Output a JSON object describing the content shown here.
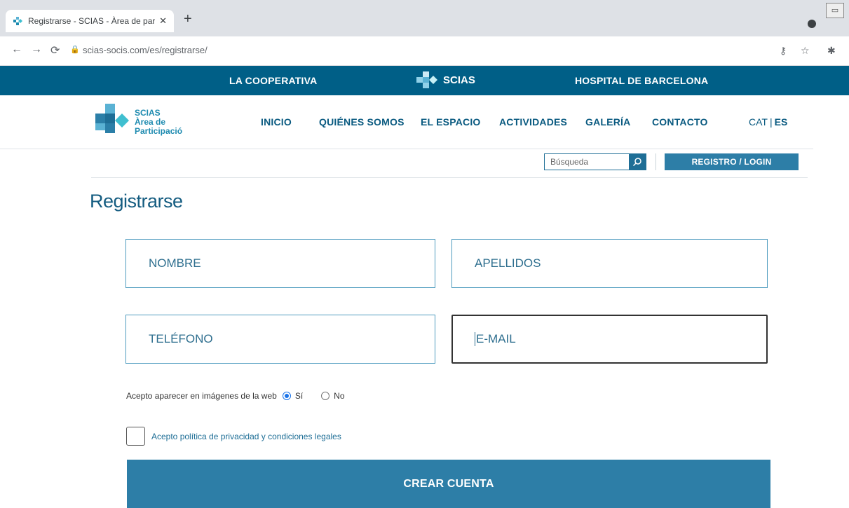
{
  "browser": {
    "tab_title": "Registrarse - SCIAS - Àrea de par",
    "tab_close": "✕",
    "new_tab": "+",
    "url": "scias-socis.com/es/registrarse/"
  },
  "topbar": {
    "left_link": "LA COOPERATIVA",
    "brand": "SCIAS",
    "right_link": "HOSPITAL DE BARCELONA"
  },
  "logo": {
    "line1": "SCIAS",
    "line2": "Àrea de",
    "line3": "Participació"
  },
  "nav": {
    "items": [
      "INICIO",
      "QUIÉNES SOMOS",
      "EL ESPACIO",
      "ACTIVIDADES",
      "GALERÍA",
      "CONTACTO"
    ],
    "lang_cat": "CAT",
    "lang_sep": "|",
    "lang_es": "ES"
  },
  "search": {
    "placeholder": "Búsqueda"
  },
  "login_button": "REGISTRO / LOGIN",
  "page": {
    "title": "Registrarse"
  },
  "form": {
    "nombre": "NOMBRE",
    "apellidos": "APELLIDOS",
    "telefono": "TELÉFONO",
    "email": "E-MAIL",
    "images_consent": "Acepto aparecer en imágenes de la web",
    "yes": "Sí",
    "no": "No",
    "terms": "Acepto política de privacidad y condiciones legales",
    "submit": "CREAR CUENTA"
  },
  "colors": {
    "brand_dark": "#005f87",
    "brand_button": "#2d7ea7",
    "accent": "#1e8bb0"
  }
}
